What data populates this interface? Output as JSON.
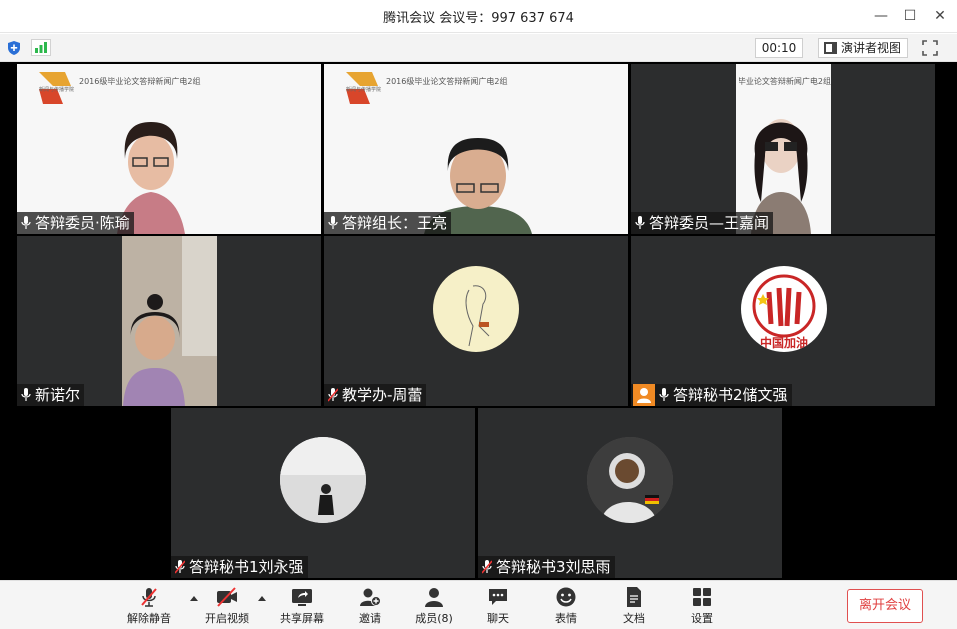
{
  "window": {
    "title": "腾讯会议  会议号：997 637 674",
    "min": "—",
    "max": "☐",
    "close": "✕"
  },
  "statusbar": {
    "timer": "00:10",
    "speaker_view": "演讲者视图"
  },
  "slide": {
    "heading": "2016级毕业论文答辩新闻广电2组",
    "school": "新闻与传播学院"
  },
  "participants": [
    {
      "name": "答辩委员·陈瑜",
      "mic": "on"
    },
    {
      "name": "答辩组长：王亮",
      "mic": "on"
    },
    {
      "name": "答辩委员—王嘉闻",
      "mic": "on"
    },
    {
      "name": "新诺尔",
      "mic": "on"
    },
    {
      "name": "教学办-周蕾",
      "mic": "muted"
    },
    {
      "name": "答辩秘书2储文强",
      "mic": "on"
    },
    {
      "name": "答辩秘书1刘永强",
      "mic": "muted"
    },
    {
      "name": "答辩秘书3刘思雨",
      "mic": "muted"
    }
  ],
  "avatar_text": {
    "logo": "中国加油"
  },
  "toolbar": {
    "unmute": "解除静音",
    "start_video": "开启视频",
    "share_screen": "共享屏幕",
    "invite": "邀请",
    "members": "成员(8)",
    "chat": "聊天",
    "emoji": "表情",
    "docs": "文档",
    "settings": "设置",
    "leave": "离开会议"
  },
  "colors": {
    "accent_green": "#2db84d",
    "leave_red": "#e04040",
    "tile_bg": "#2c2d2e"
  }
}
